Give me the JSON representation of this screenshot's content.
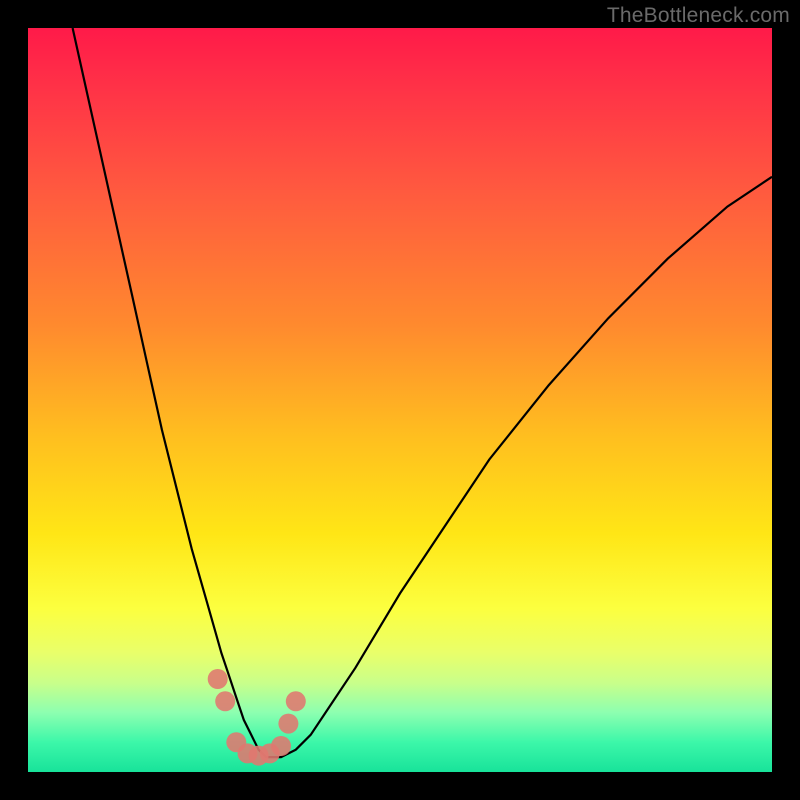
{
  "watermark": {
    "text": "TheBottleneck.com"
  },
  "chart_data": {
    "type": "line",
    "title": "",
    "xlabel": "",
    "ylabel": "",
    "xlim": [
      0,
      100
    ],
    "ylim": [
      0,
      100
    ],
    "series": [
      {
        "name": "bottleneck-curve",
        "x": [
          6,
          8,
          10,
          12,
          14,
          16,
          18,
          20,
          22,
          24,
          26,
          27,
          28,
          29,
          30,
          31,
          32,
          33,
          34,
          36,
          38,
          40,
          44,
          50,
          56,
          62,
          70,
          78,
          86,
          94,
          100
        ],
        "y": [
          100,
          91,
          82,
          73,
          64,
          55,
          46,
          38,
          30,
          23,
          16,
          13,
          10,
          7,
          5,
          3,
          2,
          2,
          2,
          3,
          5,
          8,
          14,
          24,
          33,
          42,
          52,
          61,
          69,
          76,
          80
        ]
      }
    ],
    "markers": {
      "name": "highlight-points",
      "color": "#e0786f",
      "x": [
        25.5,
        26.5,
        28.0,
        29.5,
        31.0,
        32.5,
        34.0,
        35.0,
        36.0
      ],
      "y": [
        12.5,
        9.5,
        4.0,
        2.5,
        2.2,
        2.5,
        3.5,
        6.5,
        9.5
      ]
    },
    "gradient_note": "background encodes bottleneck severity: red=high, green=low"
  }
}
